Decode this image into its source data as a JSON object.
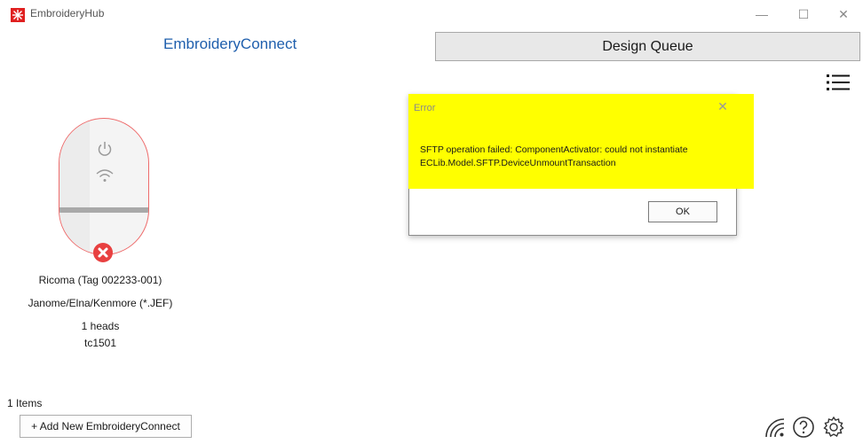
{
  "window": {
    "title": "EmbroideryHub",
    "logo_color": "#e02020",
    "minimize_glyph": "—",
    "maximize_glyph": "☐",
    "close_glyph": "✕"
  },
  "tabs": {
    "connect_label": "EmbroideryConnect",
    "queue_label": "Design Queue"
  },
  "device": {
    "name": "Ricoma  (Tag 002233-001)",
    "format": "Janome/Elna/Kenmore (*.JEF)",
    "heads": "1 heads",
    "id": "tc1501",
    "status": "error",
    "status_color": "#e84040"
  },
  "footer": {
    "items_count": "1 Items",
    "add_button_label": "+ Add New EmbroideryConnect"
  },
  "dialog": {
    "title": "Error",
    "message_line1": "SFTP operation failed: ComponentActivator: could not instantiate",
    "message_line2": "ECLib.Model.SFTP.DeviceUnmountTransaction",
    "ok_label": "OK",
    "close_glyph": "✕",
    "highlight_color": "#ffff00"
  },
  "icons": {
    "menu": "list-menu-icon",
    "power": "power-icon",
    "wifi": "wifi-icon",
    "help": "help-icon",
    "settings": "gear-icon"
  }
}
